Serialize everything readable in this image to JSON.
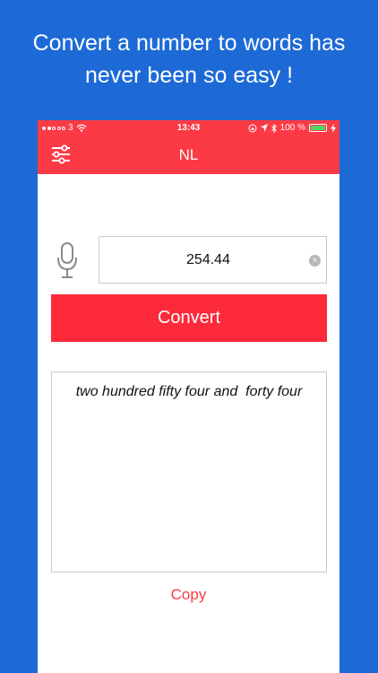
{
  "promo": {
    "line1": "Convert a number to words has",
    "line2": "never been so easy !"
  },
  "status_bar": {
    "carrier": "3",
    "time": "13:43",
    "battery": "100 %"
  },
  "navbar": {
    "title": "NL"
  },
  "input": {
    "value": "254.44"
  },
  "convert_button": {
    "label": "Convert"
  },
  "result": {
    "text": "two hundred fifty four and  forty four"
  },
  "copy": {
    "label": "Copy"
  },
  "colors": {
    "background": "#1d6ad6",
    "accent": "#fc3a45",
    "battery_fill": "#4cd964"
  },
  "icons": [
    "signal-dots-icon",
    "wifi-icon",
    "settings-sliders-icon",
    "microphone-icon",
    "clear-icon",
    "lock-rotation-icon",
    "location-icon",
    "bluetooth-icon",
    "battery-icon",
    "charging-icon"
  ]
}
